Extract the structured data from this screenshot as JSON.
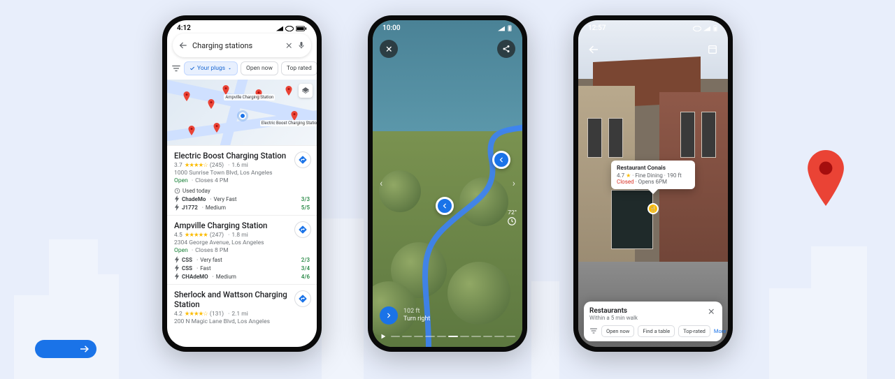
{
  "background": {
    "arrow_color": "#1a73e8",
    "pin_color": "#ea4335"
  },
  "phone1": {
    "time": "4:12",
    "search_query": "Charging stations",
    "chip_plugs": "Your plugs",
    "chip_open": "Open now",
    "chip_top": "Top rated",
    "map_labels": {
      "l1": "Ampville Charging\nStation",
      "l2": "Electric Boost\nCharging Station"
    },
    "results": [
      {
        "name": "Electric Boost Charging Station",
        "rating": "3.7",
        "reviews": "(245)",
        "distance": "1.6 mi",
        "address": "1000 Sunrise Town Blvd, Los Angeles",
        "open": "Open",
        "hours": "Closes 4 PM",
        "used": "Used today",
        "plugs": [
          {
            "name": "ChadeMo",
            "speed": "Very Fast",
            "avail": "3/3"
          },
          {
            "name": "J1772",
            "speed": "Medium",
            "avail": "5/5"
          }
        ]
      },
      {
        "name": "Ampville Charging Station",
        "rating": "4.5",
        "reviews": "(247)",
        "distance": "1.8 mi",
        "address": "2304 George Avenue, Los Angeles",
        "open": "Open",
        "hours": "Closes 8 PM",
        "plugs": [
          {
            "name": "CSS",
            "speed": "Very fast",
            "avail": "2/3"
          },
          {
            "name": "CSS",
            "speed": "Fast",
            "avail": "3/4"
          },
          {
            "name": "CHAdeMO",
            "speed": "Medium",
            "avail": "4/6"
          }
        ]
      },
      {
        "name": "Sherlock and Wattson Charging Station",
        "rating": "4.2",
        "reviews": "(131)",
        "distance": "2.1 mi",
        "address": "200 N Magic Lane Blvd, Los Angeles"
      }
    ]
  },
  "phone2": {
    "time": "10:00",
    "temperature": "72°",
    "step_distance": "102 ft",
    "step_instruction": "Turn right"
  },
  "phone3": {
    "time": "12:57",
    "tooltip": {
      "name": "Restaurant Conais",
      "rating": "4.7",
      "category": "Fine Dining",
      "distance": "190 ft",
      "status": "Closed",
      "opens": "Opens 6PM"
    },
    "sheet": {
      "title": "Restaurants",
      "subtitle": "Within a 5 min walk",
      "chip_open": "Open now",
      "chip_table": "Find a table",
      "chip_top": "Top-rated",
      "more": "More"
    }
  }
}
